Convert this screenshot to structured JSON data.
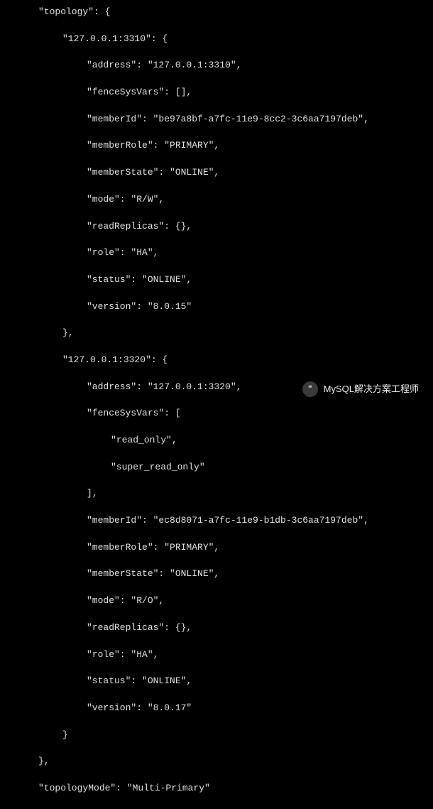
{
  "code": {
    "l1": "\"topology\": {",
    "l2": "\"127.0.0.1:3310\": {",
    "l3": "\"address\": \"127.0.0.1:3310\",",
    "l4": "\"fenceSysVars\": [],",
    "l5": "\"memberId\": \"be97a8bf-a7fc-11e9-8cc2-3c6aa7197deb\",",
    "l6": "\"memberRole\": \"PRIMARY\",",
    "l7": "\"memberState\": \"ONLINE\",",
    "l8": "\"mode\": \"R/W\",",
    "l9": "\"readReplicas\": {},",
    "l10": "\"role\": \"HA\",",
    "l11": "\"status\": \"ONLINE\",",
    "l12": "\"version\": \"8.0.15\"",
    "l13": "},",
    "l14": "\"127.0.0.1:3320\": {",
    "l15": "\"address\": \"127.0.0.1:3320\",",
    "l16": "\"fenceSysVars\": [",
    "l17": "\"read_only\",",
    "l18": "\"super_read_only\"",
    "l19": "],",
    "l20": "\"memberId\": \"ec8d8071-a7fc-11e9-b1db-3c6aa7197deb\",",
    "l21": "\"memberRole\": \"PRIMARY\",",
    "l22": "\"memberState\": \"ONLINE\",",
    "l23": "\"mode\": \"R/O\",",
    "l24": "\"readReplicas\": {},",
    "l25": "\"role\": \"HA\",",
    "l26": "\"status\": \"ONLINE\",",
    "l27": "\"version\": \"8.0.17\"",
    "l28": "}",
    "l29": "},",
    "l30": "\"topologyMode\": \"Multi-Primary\""
  },
  "badge": {
    "icon_glyph": "❝",
    "label": "MySQL解决方案工程师"
  }
}
